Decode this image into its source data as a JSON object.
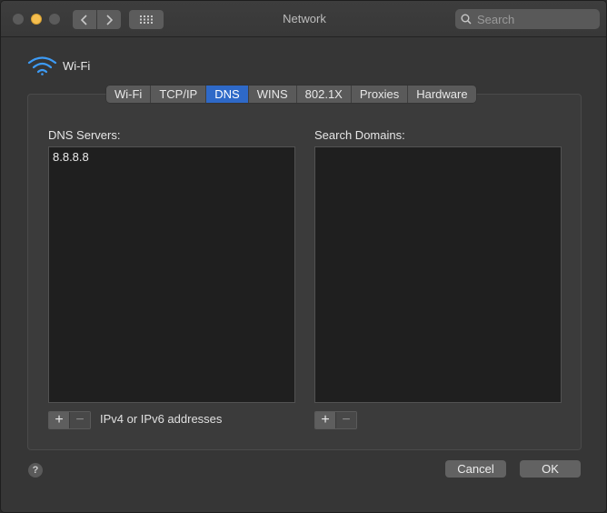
{
  "window": {
    "title": "Network",
    "search_placeholder": "Search"
  },
  "interface": {
    "name": "Wi-Fi",
    "icon": "wifi-icon",
    "icon_color": "#3d9bf5"
  },
  "tabs": [
    {
      "label": "Wi-Fi",
      "active": false
    },
    {
      "label": "TCP/IP",
      "active": false
    },
    {
      "label": "DNS",
      "active": true
    },
    {
      "label": "WINS",
      "active": false
    },
    {
      "label": "802.1X",
      "active": false
    },
    {
      "label": "Proxies",
      "active": false
    },
    {
      "label": "Hardware",
      "active": false
    }
  ],
  "dns": {
    "servers_label": "DNS Servers:",
    "servers": [
      "8.8.8.8"
    ],
    "hint": "IPv4 or IPv6 addresses",
    "domains_label": "Search Domains:",
    "domains": []
  },
  "buttons": {
    "plus": "+",
    "minus": "−",
    "help": "?",
    "cancel": "Cancel",
    "ok": "OK"
  },
  "colors": {
    "accent": "#2e69c8",
    "minimize_light": "#f5be4f"
  }
}
